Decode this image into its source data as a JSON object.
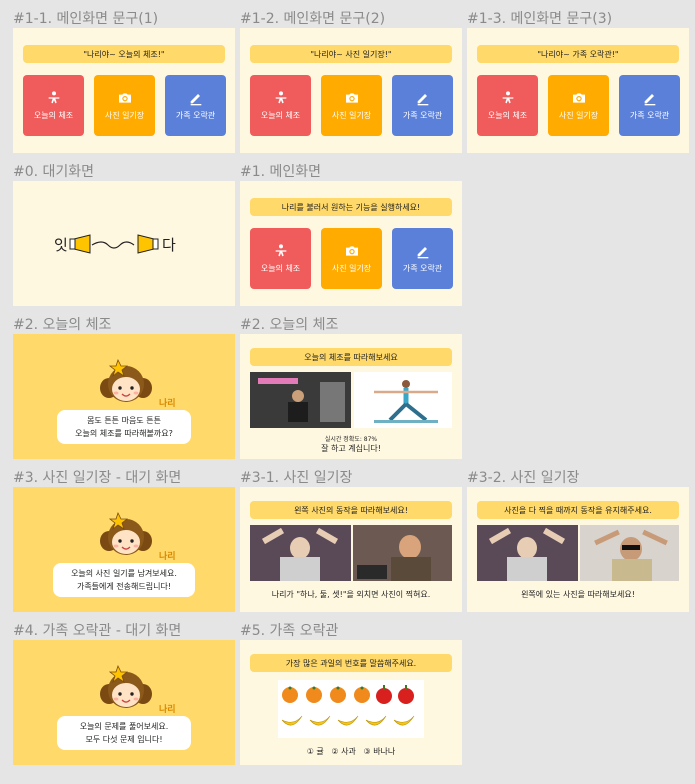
{
  "labels": {
    "m1": "#1-1. 메인화면 문구(1)",
    "m2": "#1-2. 메인화면 문구(2)",
    "m3": "#1-3. 메인화면 문구(3)",
    "idle": "#0. 대기화면",
    "main": "#1. 메인화면",
    "ex_idle": "#2. 오늘의 체조",
    "ex": "#2. 오늘의 체조",
    "photo_idle": "#3. 사진 일기장 - 대기 화면",
    "photo1": "#3-1. 사진 일기장",
    "photo2": "#3-2. 사진 일기장",
    "quiz_idle": "#4. 가족 오락관 - 대기 화면",
    "quiz": "#5. 가족 오락관"
  },
  "banners": {
    "m1": "\"나리야~ 오늘의 체조!\"",
    "m2": "\"나리야~ 사진 일기장!\"",
    "m3": "\"나리야~ 가족 오락관!\"",
    "main": "나리를 불러서 원하는 기능을 실행하세요!",
    "ex": "오늘의 체조를 따라해보세요",
    "photo1": "왼쪽 사진의 동작을 따라해보세요!",
    "photo2": "사진을 다 찍을 때까지 동작을 유지해주세요.",
    "quiz": "가장 많은 과일의 번호를 말씀해주세요."
  },
  "buttons": {
    "exercise": "오늘의 체조",
    "photo": "사진 일기장",
    "family": "가족 오락관"
  },
  "logo": "잇다",
  "mascot_name": "나리",
  "bubbles": {
    "ex_1": "몸도 튼튼 마음도 튼튼",
    "ex_2": "오늘의 체조를 따라해볼까요?",
    "photo_1": "오늘의 사진 일기를 남겨보세요.",
    "photo_2": "가족들에게 전송해드립니다!",
    "quiz_1": "오늘의 문제를 풀어보세요.",
    "quiz_2": "모두 다섯 문제 입니다!"
  },
  "exercise": {
    "accuracy": "실시간 정확도: 87%",
    "feedback": "잘 하고 계십니다!"
  },
  "photo": {
    "caption1": "나리가 \"하나, 둘, 셋!\"을 외치면 사진이 찍혀요.",
    "caption2": "왼쪽에 있는 사진을 따라해보세요!"
  },
  "quiz": {
    "options": "① 귤   ② 사과   ③ 바나나"
  },
  "colors": {
    "cream": "#fff8e1",
    "yellow": "#ffd96a",
    "red": "#f05b5b",
    "orange": "#ffab00",
    "blue": "#5b80d9"
  },
  "icons": [
    "exercise-icon",
    "camera-icon",
    "pencil-icon"
  ]
}
